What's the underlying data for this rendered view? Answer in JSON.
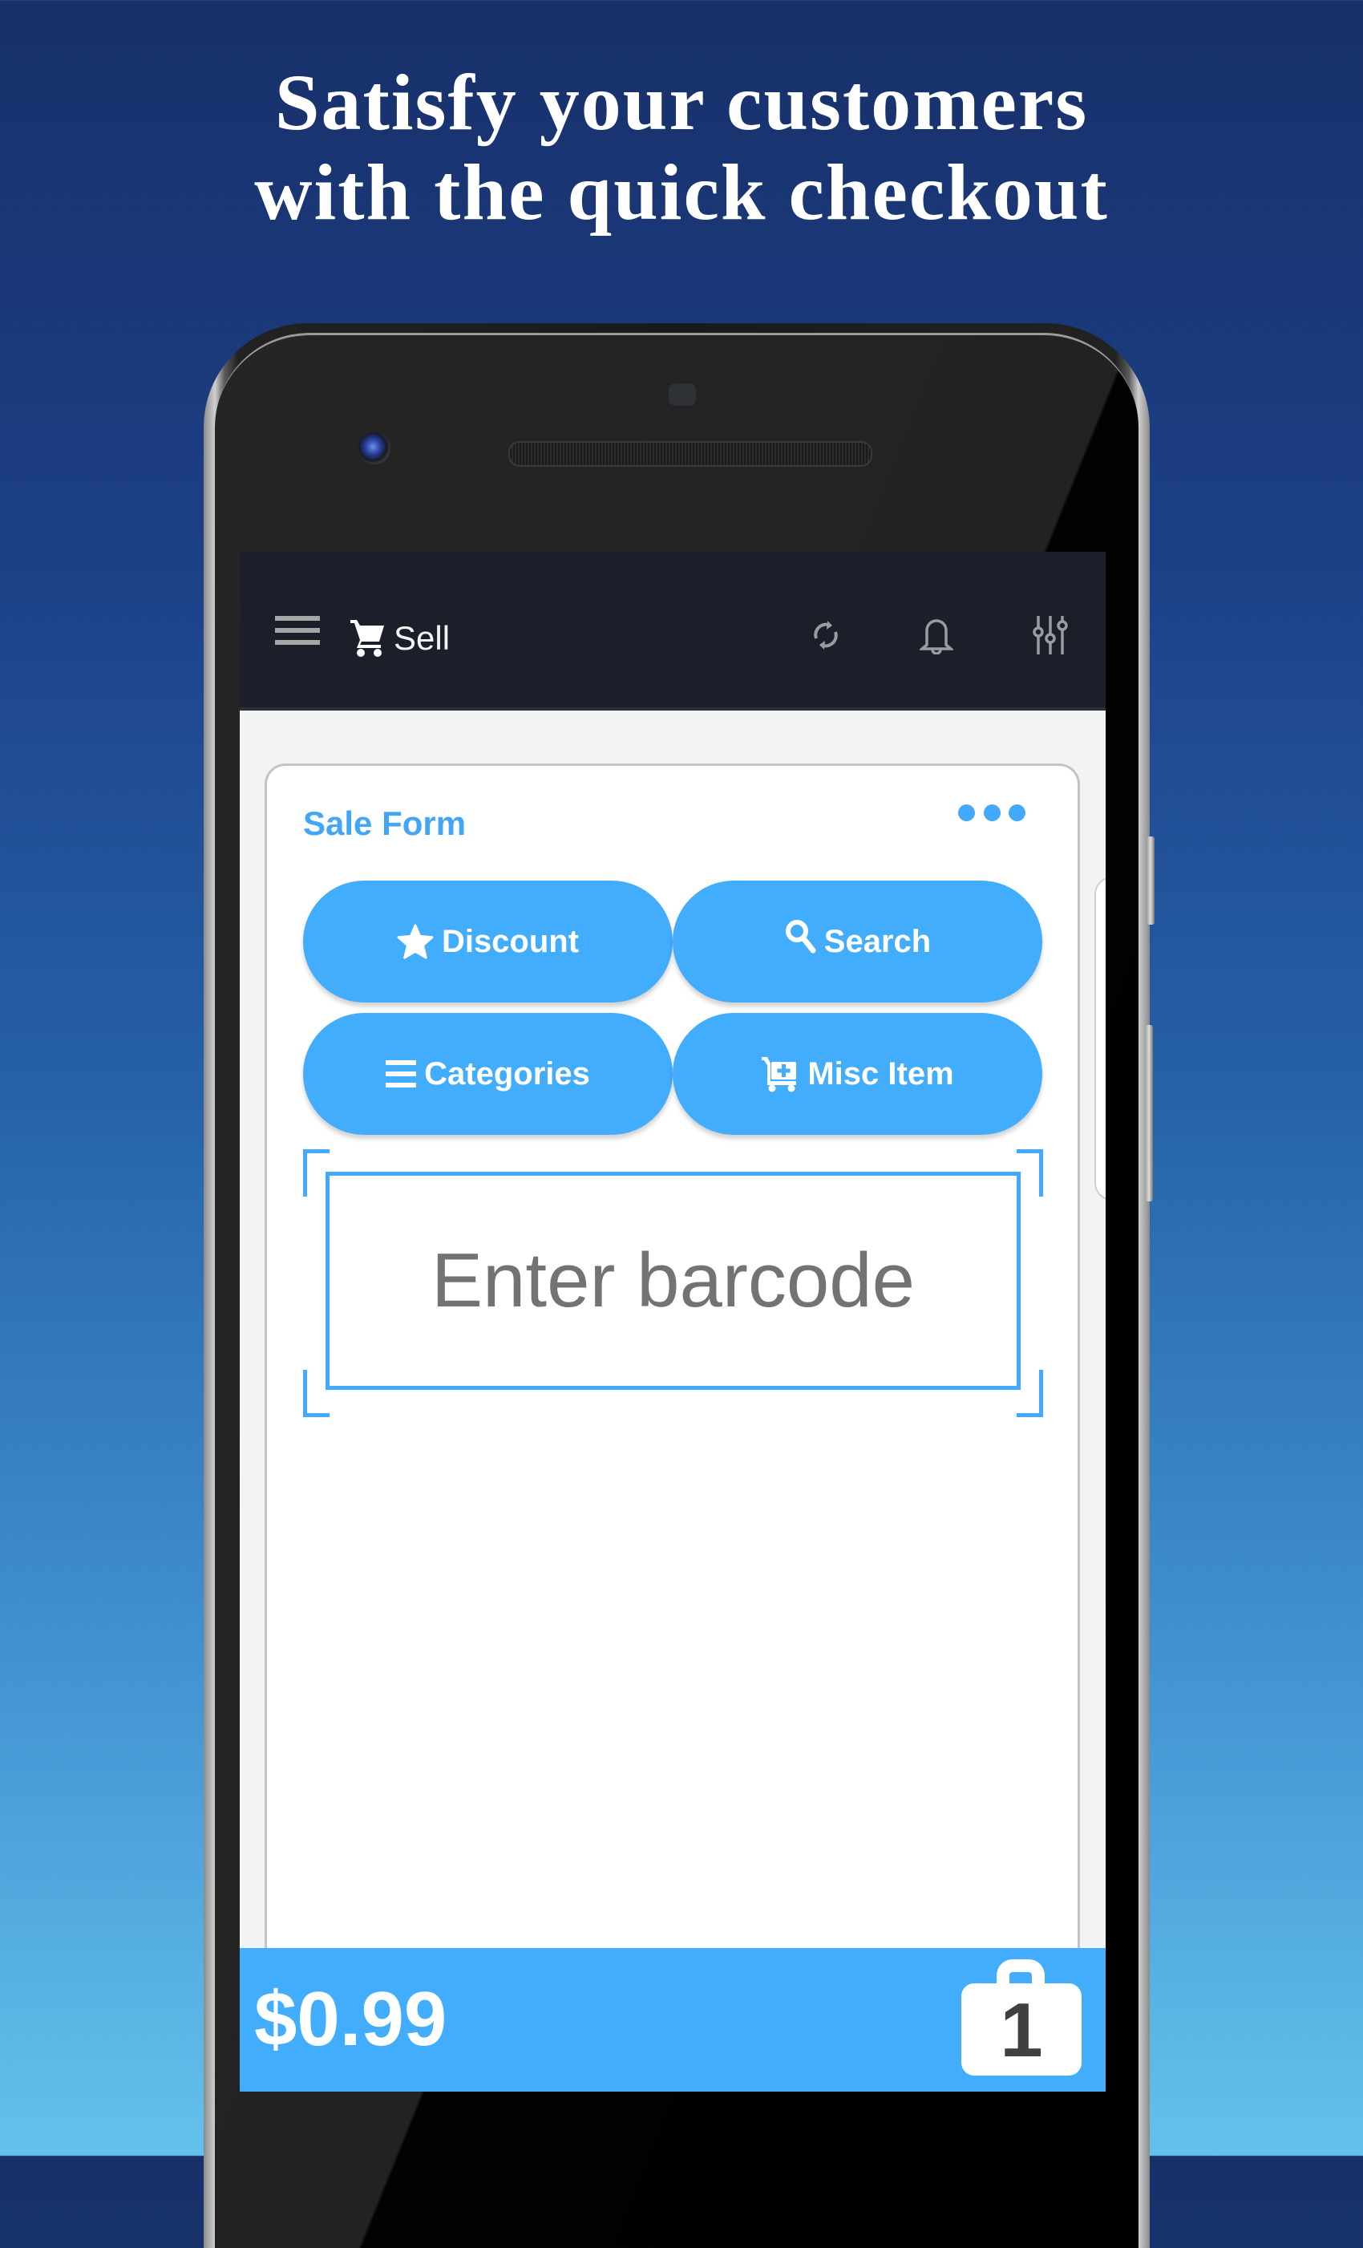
{
  "headline": {
    "line1": "Satisfy your customers",
    "line2": "with the quick checkout"
  },
  "toolbar": {
    "menu_icon": "hamburger-menu-icon",
    "title_icon": "shopping-cart-icon",
    "title": "Sell",
    "actions": [
      {
        "name": "sync",
        "icon": "sync-icon"
      },
      {
        "name": "notifications",
        "icon": "bell-icon"
      },
      {
        "name": "settings",
        "icon": "sliders-icon"
      }
    ]
  },
  "sale_form": {
    "title": "Sale Form",
    "more_icon": "more-horizontal-icon",
    "buttons": [
      {
        "label": "Discount",
        "icon": "star-icon"
      },
      {
        "label": "Search",
        "icon": "search-icon"
      },
      {
        "label": "Categories",
        "icon": "list-icon"
      },
      {
        "label": "Misc Item",
        "icon": "cart-plus-icon"
      }
    ],
    "barcode_placeholder": "Enter barcode"
  },
  "bottom_bar": {
    "total": "$0.99",
    "cart_icon": "shopping-bag-icon",
    "item_count": "1"
  },
  "colors": {
    "accent": "#42acfd",
    "toolbar_bg": "#1b1f29",
    "placeholder_text": "#737373"
  }
}
